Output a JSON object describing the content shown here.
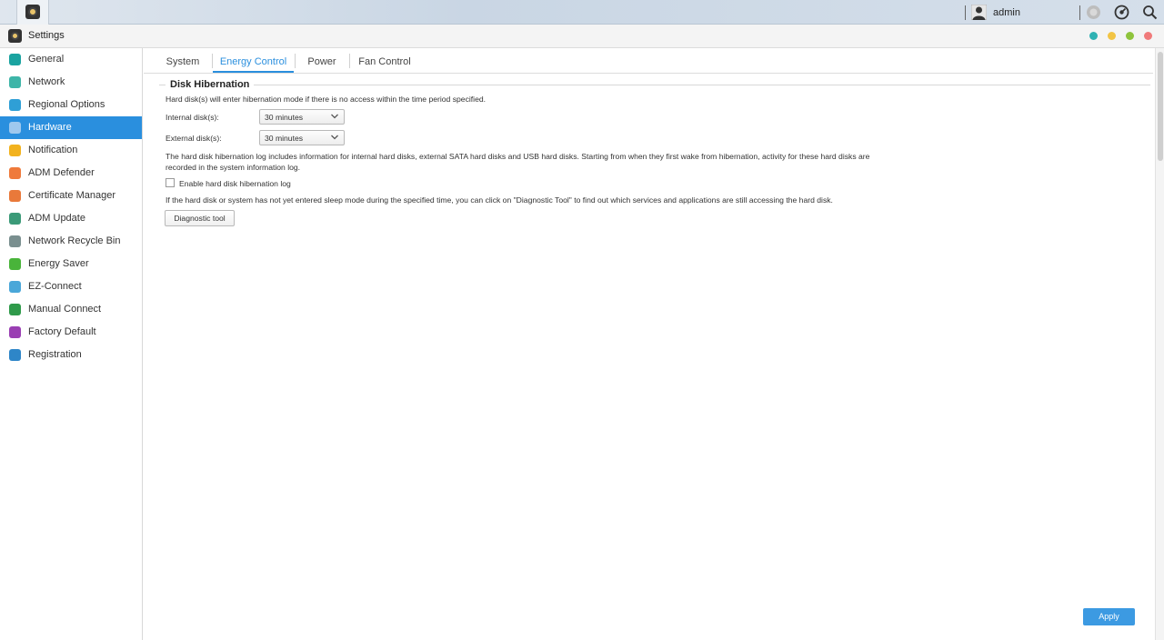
{
  "taskbar": {
    "user": "admin"
  },
  "window": {
    "title": "Settings"
  },
  "colors": {
    "accent": "#2a8fde",
    "dot_teal": "#2fb2b3",
    "dot_yellow": "#f2c444",
    "dot_green": "#8fc43c",
    "dot_red": "#f07a7a"
  },
  "sidebar": {
    "items": [
      {
        "label": "General",
        "icon": "general-icon",
        "color": "#1aa3a0"
      },
      {
        "label": "Network",
        "icon": "globe-icon",
        "color": "#3eb5a8"
      },
      {
        "label": "Regional Options",
        "icon": "regional-icon",
        "color": "#2f9fd6"
      },
      {
        "label": "Hardware",
        "icon": "hardware-icon",
        "color": "#9fc8ee"
      },
      {
        "label": "Notification",
        "icon": "notification-icon",
        "color": "#f2b21e"
      },
      {
        "label": "ADM Defender",
        "icon": "shield-wall-icon",
        "color": "#ef7a3b"
      },
      {
        "label": "Certificate Manager",
        "icon": "certificate-icon",
        "color": "#e9793a"
      },
      {
        "label": "ADM Update",
        "icon": "update-icon",
        "color": "#3b9a78"
      },
      {
        "label": "Network Recycle Bin",
        "icon": "recycle-bin-icon",
        "color": "#7a8f8f"
      },
      {
        "label": "Energy Saver",
        "icon": "leaf-icon",
        "color": "#49b43a"
      },
      {
        "label": "EZ-Connect",
        "icon": "cloud-icon",
        "color": "#4aa7d9"
      },
      {
        "label": "Manual Connect",
        "icon": "connect-icon",
        "color": "#2f9a4a"
      },
      {
        "label": "Factory Default",
        "icon": "undo-icon",
        "color": "#9a3fb3"
      },
      {
        "label": "Registration",
        "icon": "registration-icon",
        "color": "#2e86c8"
      }
    ]
  },
  "tabs": [
    {
      "label": "System"
    },
    {
      "label": "Energy Control"
    },
    {
      "label": "Power"
    },
    {
      "label": "Fan Control"
    }
  ],
  "content": {
    "section_title": "Disk Hibernation",
    "intro": "Hard disk(s) will enter hibernation mode if there is no access within the time period specified.",
    "internal_label": "Internal disk(s):",
    "internal_value": "30 minutes",
    "external_label": "External disk(s):",
    "external_value": "30 minutes",
    "log_info_line1": "The hard disk hibernation log includes information for internal hard disks, external SATA hard disks and USB hard disks. Starting from when they first wake from hibernation, activity for these hard disks are",
    "log_info_line2": "recorded in the system information log.",
    "enable_log_label": "Enable hard disk hibernation log",
    "enable_log_checked": false,
    "diagnostic_info": "If the hard disk or system has not yet entered sleep mode during the specified time, you can click on \"Diagnostic Tool\" to find out which services and applications are still accessing the hard disk.",
    "diagnostic_button": "Diagnostic tool",
    "apply_button": "Apply"
  }
}
